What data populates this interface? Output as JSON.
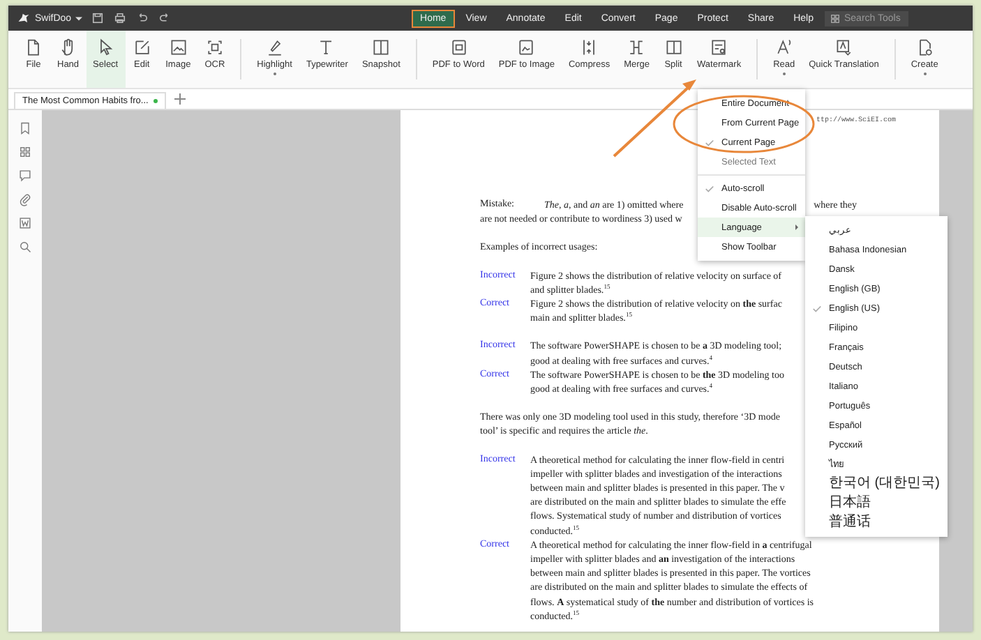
{
  "app": {
    "name": "SwifDoo"
  },
  "menu_bar": [
    {
      "label": "Home",
      "selected": true,
      "highlighted": true
    },
    {
      "label": "View",
      "selected": false,
      "highlighted": false
    },
    {
      "label": "Annotate",
      "selected": false,
      "highlighted": false
    },
    {
      "label": "Edit",
      "selected": false,
      "highlighted": false
    },
    {
      "label": "Convert",
      "selected": false,
      "highlighted": false
    },
    {
      "label": "Page",
      "selected": false,
      "highlighted": false
    },
    {
      "label": "Protect",
      "selected": false,
      "highlighted": false
    },
    {
      "label": "Share",
      "selected": false,
      "highlighted": false
    },
    {
      "label": "Help",
      "selected": false,
      "highlighted": false
    }
  ],
  "search": {
    "placeholder": "Search Tools"
  },
  "toolbar": [
    [
      {
        "label": "File",
        "selected": false,
        "dropdown": false
      },
      {
        "label": "Hand",
        "selected": false,
        "dropdown": false
      },
      {
        "label": "Select",
        "selected": true,
        "dropdown": false
      },
      {
        "label": "Edit",
        "selected": false,
        "dropdown": false
      },
      {
        "label": "Image",
        "selected": false,
        "dropdown": false
      },
      {
        "label": "OCR",
        "selected": false,
        "dropdown": false
      }
    ],
    [
      {
        "label": "Highlight",
        "selected": false,
        "dropdown": true
      },
      {
        "label": "Typewriter",
        "selected": false,
        "dropdown": false
      },
      {
        "label": "Snapshot",
        "selected": false,
        "dropdown": false
      }
    ],
    [
      {
        "label": "PDF to Word",
        "selected": false,
        "dropdown": false
      },
      {
        "label": "PDF to Image",
        "selected": false,
        "dropdown": false
      },
      {
        "label": "Compress",
        "selected": false,
        "dropdown": false
      },
      {
        "label": "Merge",
        "selected": false,
        "dropdown": false
      },
      {
        "label": "Split",
        "selected": false,
        "dropdown": false
      },
      {
        "label": "Watermark",
        "selected": false,
        "dropdown": false
      }
    ],
    [
      {
        "label": "Read",
        "selected": false,
        "dropdown": true
      },
      {
        "label": "Quick Translation",
        "selected": false,
        "dropdown": false
      }
    ],
    [
      {
        "label": "Create",
        "selected": false,
        "dropdown": true
      }
    ]
  ],
  "doc_tabs": [
    {
      "title": "The Most Common Habits fro...",
      "modified": true,
      "selected": true
    }
  ],
  "document": {
    "watermark": "ttp://www.SciEI.com",
    "blocks": [
      {
        "kind": "mistake",
        "label": "Mistake:",
        "lines": [
          {
            "text": "*The*, *a*, and *an* are 1) omitted where",
            "tail": "where they"
          }
        ]
      },
      {
        "kind": "plain",
        "lines": [
          {
            "text": "are not needed or contribute to wordiness 3) used w"
          }
        ]
      },
      {
        "kind": "spacer"
      },
      {
        "kind": "plain",
        "lines": [
          {
            "text": "Examples of incorrect usages:"
          }
        ]
      },
      {
        "kind": "spacer"
      },
      {
        "kind": "example",
        "label": "Incorrect",
        "lines": [
          {
            "text": "Figure 2 shows the distribution of relative velocity on surface of"
          },
          {
            "text": "and splitter blades.$^{15}$"
          }
        ]
      },
      {
        "kind": "example",
        "label": "Correct",
        "lines": [
          {
            "text": "Figure 2 shows the distribution of relative velocity on **the** surfac"
          },
          {
            "text": "main and splitter blades.$^{15}$"
          }
        ]
      },
      {
        "kind": "spacer"
      },
      {
        "kind": "example",
        "label": "Incorrect",
        "lines": [
          {
            "text": "The software PowerSHAPE is chosen to be **a** 3D modeling tool;"
          },
          {
            "text": "good at dealing with free surfaces and curves.$^{4}$"
          }
        ]
      },
      {
        "kind": "example",
        "label": "Correct",
        "lines": [
          {
            "text": "The software PowerSHAPE is chosen to be **the** 3D modeling too"
          },
          {
            "text": "good at dealing with free surfaces and curves.$^{4}$"
          }
        ]
      },
      {
        "kind": "spacer"
      },
      {
        "kind": "plain",
        "lines": [
          {
            "text": "There was only one 3D modeling tool used in this study, therefore ‘3D mode"
          },
          {
            "text": "tool’ is specific and requires the article *the*."
          }
        ]
      },
      {
        "kind": "spacer"
      },
      {
        "kind": "example",
        "label": "Incorrect",
        "lines": [
          {
            "text": "A theoretical method for calculating the inner flow-field in centri"
          },
          {
            "text": "impeller with splitter blades and investigation of the interactions"
          },
          {
            "text": "between main and splitter blades is presented in this paper. The v"
          },
          {
            "text": "are distributed on the main and splitter blades to simulate the effe"
          },
          {
            "text": "flows. Systematical study of number and distribution of vortices"
          },
          {
            "text": "conducted.$^{15}$"
          }
        ]
      },
      {
        "kind": "example",
        "label": "Correct",
        "lines": [
          {
            "text": "A theoretical method for calculating the inner flow-field in **a** centrifugal"
          },
          {
            "text": "impeller with splitter blades and **an** investigation of the interactions"
          },
          {
            "text": "between main and splitter blades is presented in this paper. The vortices"
          },
          {
            "text": "are distributed on the main and splitter blades to simulate the effects of"
          },
          {
            "text": "flows. **A** systematical study of **the** number and distribution of vortices is"
          },
          {
            "text": "conducted.$^{15}$"
          }
        ]
      }
    ]
  },
  "read_menu": [
    {
      "kind": "item",
      "label": "Entire Document",
      "checked": false,
      "disabled": false,
      "highlighted": false
    },
    {
      "kind": "item",
      "label": "From Current Page",
      "checked": false,
      "disabled": false,
      "highlighted": false
    },
    {
      "kind": "item",
      "label": "Current Page",
      "checked": true,
      "disabled": false,
      "highlighted": false
    },
    {
      "kind": "item",
      "label": "Selected Text",
      "checked": false,
      "disabled": true,
      "highlighted": false
    },
    {
      "kind": "separator"
    },
    {
      "kind": "item",
      "label": "Auto-scroll",
      "checked": true,
      "disabled": false,
      "highlighted": false
    },
    {
      "kind": "item",
      "label": "Disable Auto-scroll",
      "checked": false,
      "disabled": false,
      "highlighted": false
    },
    {
      "kind": "submenu",
      "label": "Language",
      "checked": false,
      "disabled": false,
      "highlighted": true
    },
    {
      "kind": "item",
      "label": "Show Toolbar",
      "checked": false,
      "disabled": false,
      "highlighted": false
    }
  ],
  "language_menu": [
    {
      "label": "عربي",
      "checked": false
    },
    {
      "label": "Bahasa Indonesian",
      "checked": false
    },
    {
      "label": "Dansk",
      "checked": false
    },
    {
      "label": "English (GB)",
      "checked": false
    },
    {
      "label": "English (US)",
      "checked": true
    },
    {
      "label": "Filipino",
      "checked": false
    },
    {
      "label": "Français",
      "checked": false
    },
    {
      "label": "Deutsch",
      "checked": false
    },
    {
      "label": "Italiano",
      "checked": false
    },
    {
      "label": "Português",
      "checked": false
    },
    {
      "label": "Español",
      "checked": false
    },
    {
      "label": "Русский",
      "checked": false
    },
    {
      "label": "ไทย",
      "checked": false
    },
    {
      "label": "한국어 (대한민국)",
      "checked": false
    },
    {
      "label": "日本語",
      "checked": false
    },
    {
      "label": "普通话",
      "checked": false
    }
  ]
}
